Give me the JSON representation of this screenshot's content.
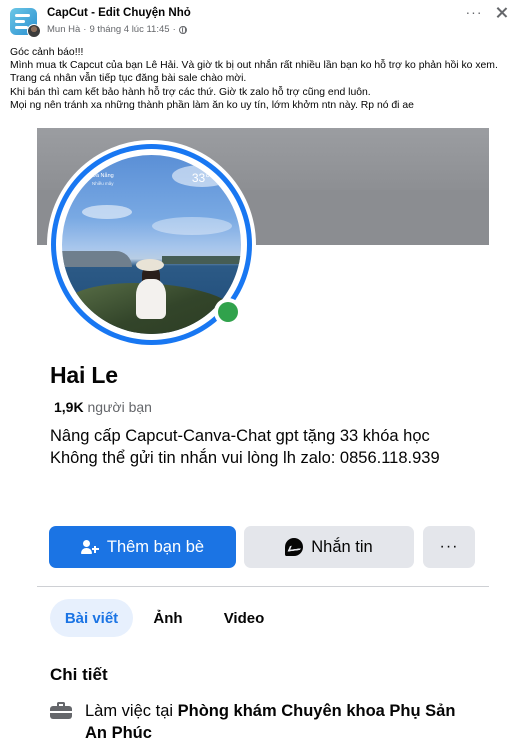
{
  "post": {
    "group_name": "CapCut - Edit Chuyện Nhỏ",
    "author": "Mun Hà",
    "time": "9 tháng 4 lúc 11:45",
    "separator": "·",
    "lines": [
      "Góc cảnh báo!!!",
      "Mình mua tk Capcut  của bạn Lê Hải. Và giờ tk bị out nhắn rất nhiều lần bạn ko hỗ trợ ko phản hồi ko xem. Trang cá nhân vẫn tiếp tục đăng bài sale chào mời.",
      "Khi bán thì cam kết bảo hành hỗ trợ các thứ. Giờ tk zalo hỗ trợ cũng end luôn.",
      "Mọi ng nên tránh xa những thành phần làm ăn ko uy tín, lớm khởm ntn này. Rp nó đi ae"
    ]
  },
  "profile": {
    "photo_overlay": {
      "city": "Đà Nẵng",
      "temperature": "33°",
      "condition": "Nhiều mây"
    },
    "name": "Hai Le",
    "friends_count": "1,9K",
    "friends_label": "người bạn",
    "bio_lines": [
      "Nâng cấp Capcut-Canva-Chat gpt tặng 33 khóa học",
      "Không thể gửi tin nhắn vui lòng lh zalo: 0856.118.939"
    ],
    "buttons": {
      "add_friend": "Thêm bạn bè",
      "message": "Nhắn tin",
      "more": "···"
    },
    "tabs": [
      "Bài viết",
      "Ảnh",
      "Video"
    ],
    "details_title": "Chi tiết",
    "work_prefix": "Làm việc tại",
    "work_place": "Phòng khám Chuyên khoa Phụ Sản An Phúc"
  },
  "colors": {
    "primary_blue": "#1b74e4",
    "online_green": "#31a24c",
    "secondary_gray": "#e4e6eb",
    "text_muted": "#65676b"
  },
  "icons": [
    "group-avatar-icon",
    "globe-icon",
    "more-dots-icon",
    "close-icon",
    "add-friend-icon",
    "messenger-icon",
    "briefcase-icon"
  ]
}
